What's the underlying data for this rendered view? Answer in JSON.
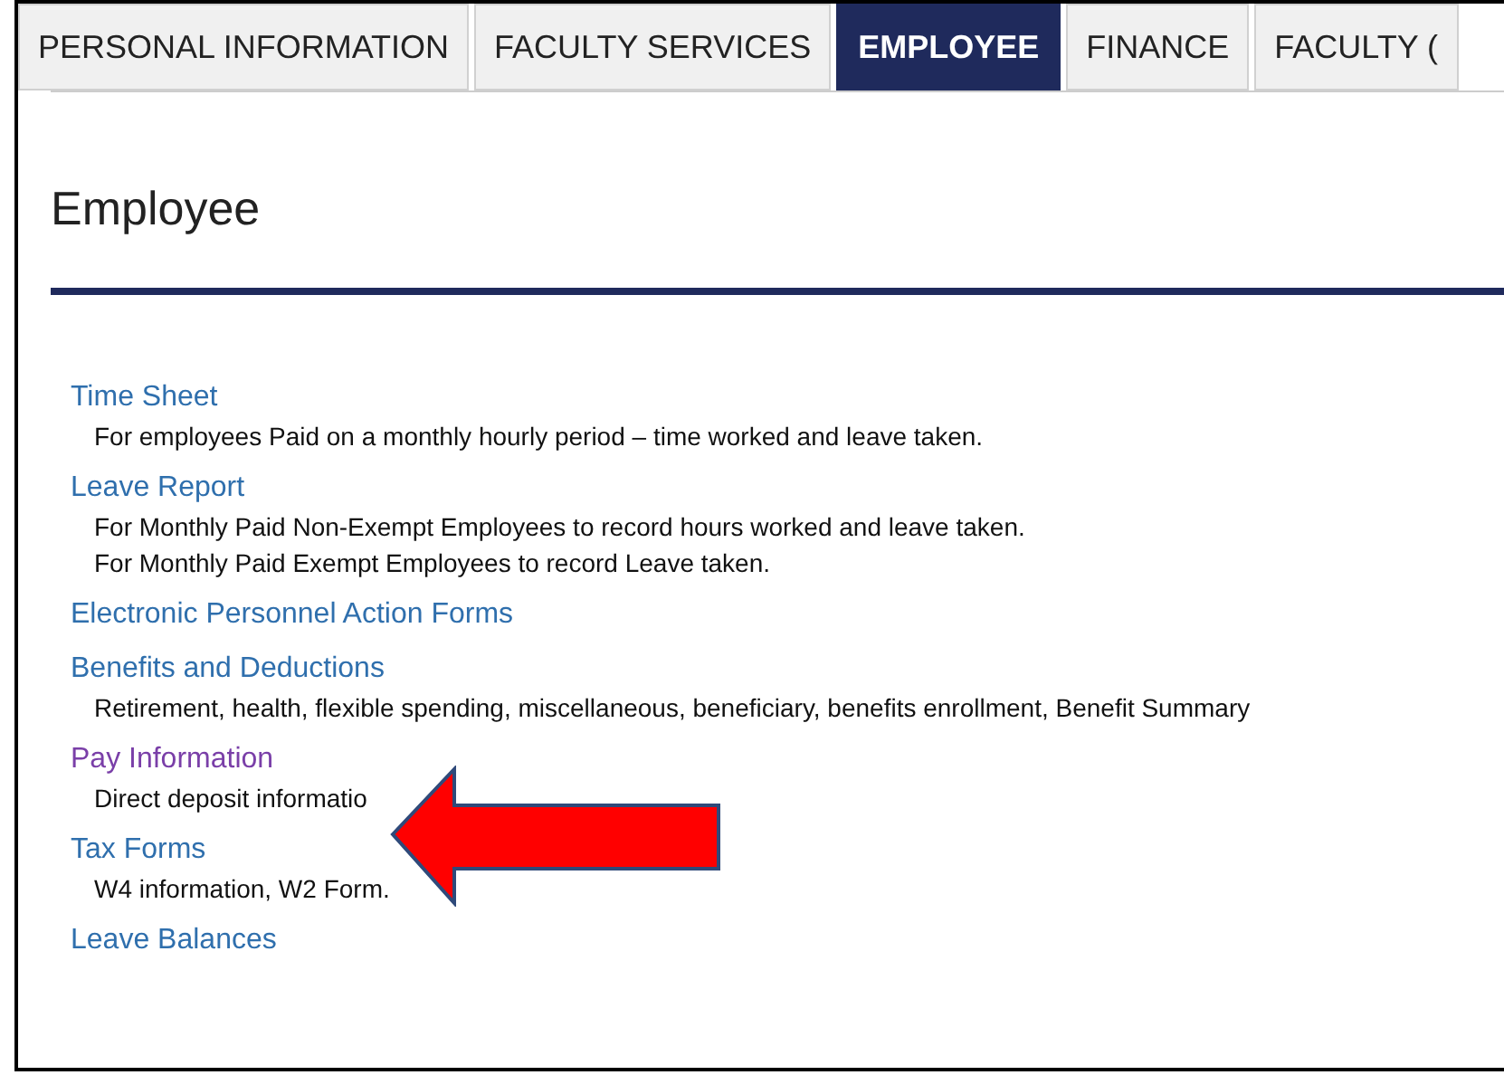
{
  "tabs": [
    {
      "label": "PERSONAL INFORMATION",
      "selected": false
    },
    {
      "label": "FACULTY SERVICES",
      "selected": false
    },
    {
      "label": "EMPLOYEE",
      "selected": true
    },
    {
      "label": "FINANCE",
      "selected": false
    },
    {
      "label": "FACULTY (",
      "selected": false
    }
  ],
  "heading": "Employee",
  "links": [
    {
      "label": "Time Sheet",
      "visited": false,
      "descriptions": [
        "For employees Paid on a monthly hourly period – time worked and leave taken."
      ]
    },
    {
      "label": "Leave Report",
      "visited": false,
      "descriptions": [
        "For Monthly Paid Non-Exempt Employees to record hours worked and leave taken.",
        "For Monthly Paid Exempt Employees to record Leave taken."
      ]
    },
    {
      "label": "Electronic Personnel Action Forms",
      "visited": false
    },
    {
      "label": "Benefits and Deductions",
      "visited": false,
      "descriptions": [
        "Retirement, health, flexible spending, miscellaneous, beneficiary, benefits enrollment, Benefit Summary"
      ]
    },
    {
      "label": "Pay Information",
      "visited": true,
      "descriptions": [
        "Direct deposit informatio"
      ]
    },
    {
      "label": "Tax Forms",
      "visited": false,
      "descriptions": [
        "W4 information, W2 Form."
      ]
    },
    {
      "label": "Leave Balances",
      "visited": false
    }
  ]
}
